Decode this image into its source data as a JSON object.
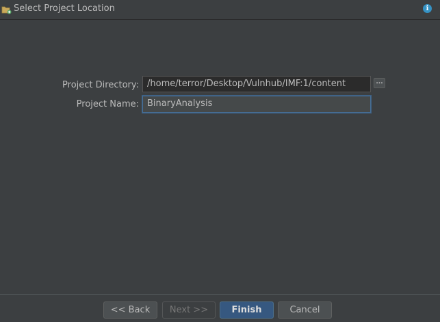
{
  "header": {
    "title": "Select Project Location",
    "info_icon": "info-icon",
    "folder_icon": "folder-new-icon"
  },
  "form": {
    "project_directory_label": "Project Directory:",
    "project_directory_value": "/home/terror/Desktop/Vulnhub/IMF:1/content",
    "browse_label": "...",
    "project_name_label": "Project Name:",
    "project_name_value": "BinaryAnalysis"
  },
  "footer": {
    "back_label": "<< Back",
    "next_label": "Next >>",
    "finish_label": "Finish",
    "cancel_label": "Cancel"
  },
  "colors": {
    "background": "#3c3f41",
    "accent": "#365880",
    "info": "#3592c4",
    "text": "#bbbbbb"
  }
}
